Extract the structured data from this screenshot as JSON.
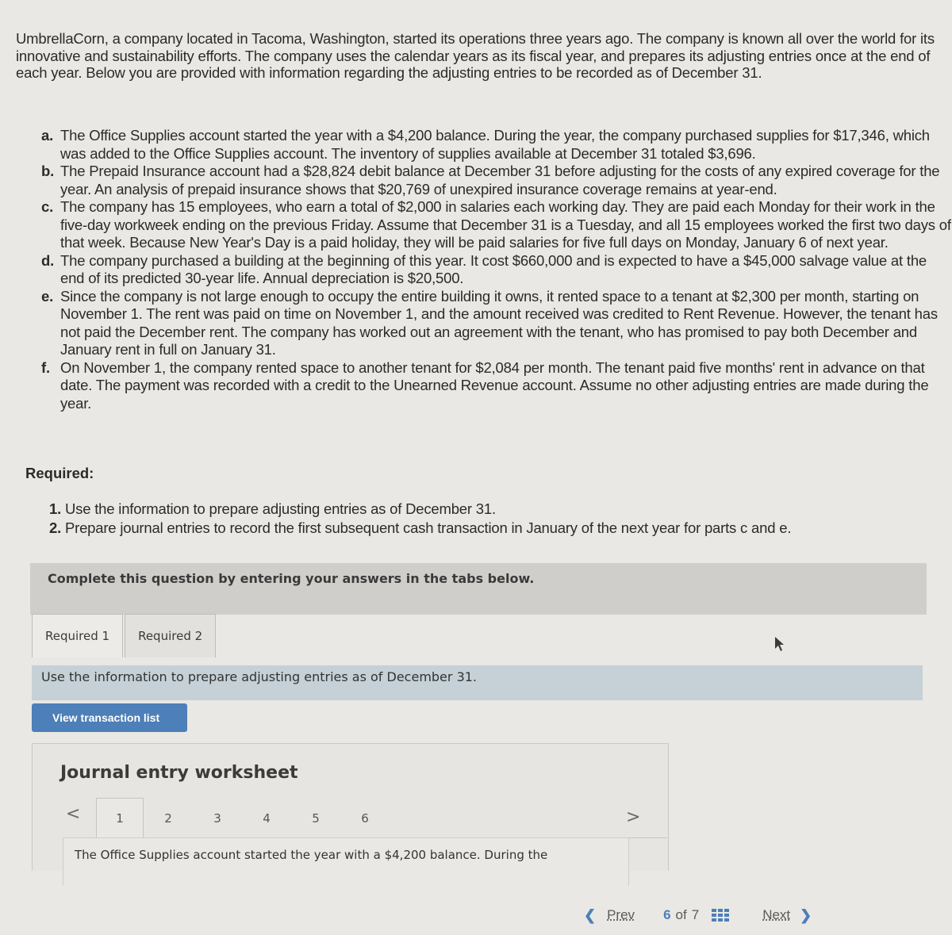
{
  "intro": "UmbrellaCorn, a company located in Tacoma, Washington, started its operations three years ago. The company is known all over the world for its innovative and sustainability efforts. The company uses the calendar years as its fiscal year, and prepares its adjusting entries once at the end of each year. Below you are provided with information regarding the adjusting entries to be recorded as of December 31.",
  "items": [
    {
      "letter": "a.",
      "text": "The Office Supplies account started the year with a $4,200 balance. During the year, the company purchased supplies for $17,346, which was added to the Office Supplies account. The inventory of supplies available at December 31 totaled $3,696."
    },
    {
      "letter": "b.",
      "text": "The Prepaid Insurance account had a $28,824 debit balance at December 31 before adjusting for the costs of any expired coverage for the year. An analysis of prepaid insurance shows that $20,769 of unexpired insurance coverage remains at year-end."
    },
    {
      "letter": "c.",
      "text": "The company has 15 employees, who earn a total of $2,000 in salaries each working day. They are paid each Monday for their work in the five-day workweek ending on the previous Friday. Assume that December 31 is a Tuesday, and all 15 employees worked the first two days of that week. Because New Year's Day is a paid holiday, they will be paid salaries for five full days on Monday, January 6 of next year."
    },
    {
      "letter": "d.",
      "text": "The company purchased a building at the beginning of this year. It cost $660,000 and is expected to have a $45,000 salvage value at the end of its predicted 30-year life. Annual depreciation is $20,500."
    },
    {
      "letter": "e.",
      "text": "Since the company is not large enough to occupy the entire building it owns, it rented space to a tenant at $2,300 per month, starting on November 1. The rent was paid on time on November 1, and the amount received was credited to Rent Revenue. However, the tenant has not paid the December rent. The company has worked out an agreement with the tenant, who has promised to pay both December and January rent in full on January 31."
    },
    {
      "letter": "f.",
      "text": "On November 1, the company rented space to another tenant for $2,084 per month. The tenant paid five months' rent in advance on that date. The payment was recorded with a credit to the Unearned Revenue account. Assume no other adjusting entries are made during the year."
    }
  ],
  "required": {
    "title": "Required:",
    "items": [
      {
        "num": "1.",
        "text": "Use the information to prepare adjusting entries as of December 31."
      },
      {
        "num": "2.",
        "text": "Prepare journal entries to record the first subsequent cash transaction in January of the next year for parts c and e."
      }
    ]
  },
  "instruction": "Complete this question by entering your answers in the tabs below.",
  "tabs": [
    {
      "label": "Required 1",
      "active": true
    },
    {
      "label": "Required 2",
      "active": false
    }
  ],
  "tab_instruction": "Use the information to prepare adjusting entries as of December 31.",
  "view_button": "View transaction list",
  "worksheet": {
    "title": "Journal entry worksheet",
    "prev": "<",
    "next": ">",
    "tabs": [
      "1",
      "2",
      "3",
      "4",
      "5",
      "6"
    ],
    "active_tab": "1",
    "content": "The Office Supplies account started the year with a $4,200 balance. During the"
  },
  "pager": {
    "prev_label": "Prev",
    "current": "6",
    "of": "of",
    "total": "7",
    "next_label": "Next",
    "prev_icon": "chevron-left-icon",
    "next_icon": "chevron-right-icon",
    "grid_icon": "grid-icon"
  },
  "colors": {
    "accent": "#4d7fb8",
    "instruction_bg": "#cfcecb",
    "tab_info_bg": "#c5d1d6"
  }
}
